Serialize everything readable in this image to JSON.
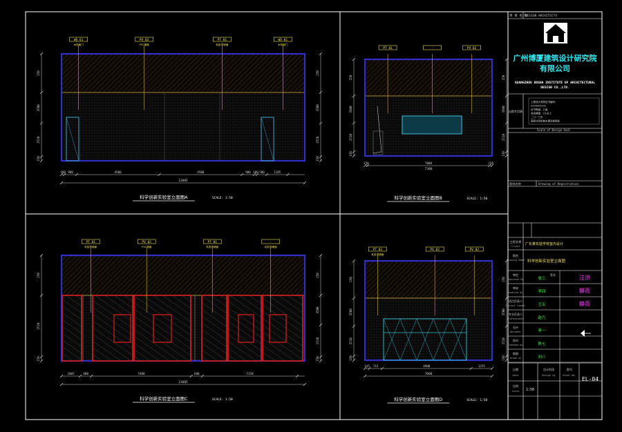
{
  "colors": {
    "background": "#000000",
    "frame": "#ffffff",
    "wall": "#3030c8",
    "hatch": "#7a5a28",
    "dim": "#d8d8d8",
    "leader": "#e0b040",
    "tag": "#f0e060",
    "panel_red": "#e02020",
    "cyan_title": "#30e8f0",
    "green_text": "#40ff40",
    "magenta_text": "#ff40ff"
  },
  "drawings": [
    {
      "id": "A",
      "title": "科学创新实验室立面图A",
      "scale": "SCALE: 1:50",
      "tags": [
        {
          "code": "WD 01",
          "note": "木饰面门"
        },
        {
          "code": "PV 02",
          "note": "PVC墙面"
        },
        {
          "code": "PT 01",
          "note": "乳胶漆墙面"
        },
        {
          "code": "WD 01",
          "note": "木饰面门"
        }
      ],
      "segment_dims": [
        "100",
        "900",
        "4500",
        "4500",
        "900",
        "100",
        "500",
        "1185"
      ],
      "overall_dim": "13085",
      "heights_left": [
        "250",
        "3500",
        "2510",
        "150"
      ],
      "heights_right": [
        "250",
        "3500",
        "2510",
        "150"
      ]
    },
    {
      "id": "B",
      "title": "科学创新实验室立面图B",
      "scale": "SCALE: 1:50",
      "tags": [
        {
          "code": "PT 01",
          "note": ""
        },
        {
          "code": "-",
          "note": ""
        },
        {
          "code": "PV 02",
          "note": ""
        }
      ],
      "segment_dims": [
        "150",
        "7000",
        "150"
      ],
      "overall_dim": "7300",
      "heights_left": [
        "250",
        "3500",
        "2510",
        "150"
      ],
      "heights_right": [
        "250",
        "3500",
        "2510",
        "150"
      ]
    },
    {
      "id": "C",
      "title": "科学创新实验室立面图C",
      "scale": "SCALE: 1:50",
      "tags": [
        {
          "code": "PT 01",
          "note": "乳胶漆墙面"
        },
        {
          "code": "PV 02",
          "note": "PVC墙面"
        },
        {
          "code": "PT 01",
          "note": "乳胶漆墙面"
        },
        {
          "code": "-",
          "note": "乳胶漆墙面"
        }
      ],
      "segment_dims": [
        "1005",
        "600",
        "5400",
        "600",
        "5150"
      ],
      "overall_dim": "13085",
      "heights_left": [
        "250",
        "2510",
        "150"
      ],
      "heights_right": [
        "250",
        "3500",
        "2510",
        "150"
      ]
    },
    {
      "id": "D",
      "title": "科学创新实验室立面图D",
      "scale": "SCALE: 1:50",
      "tags": [
        {
          "code": "PT 01",
          "note": "乳胶漆墙面"
        },
        {
          "code": "PV 02",
          "note": ""
        },
        {
          "code": "PV 02",
          "note": ""
        }
      ],
      "segment_dims": [
        "245",
        "715",
        "4900",
        "1255"
      ],
      "overall_dim": "7000",
      "heights_left": [
        "250",
        "3500",
        "2510",
        "150"
      ],
      "heights_right": [
        "250",
        "3500",
        "2510",
        "150"
      ]
    }
  ],
  "title_block": {
    "header_left": "项 目 名 称",
    "header_right": "DESIGN ARCHITECTS",
    "company_cn": "广州博厦建筑设计研究院有限公司",
    "company_cn_line1": "广州博厦建筑设计研究院",
    "company_cn_line2": "有限公司",
    "company_en_line1": "GUANGZHOU BOSHA INSTITUTE OF ARCHITECTURAL",
    "company_en_line2": "DESIGN CO.,LTD.",
    "seal_label": "出图专用章",
    "seal_lines": [
      "工程设计资质证书编号：",
      "A144005241",
      "证书等级：乙级",
      "有效期限：2018.5",
      "二〇一三年",
      "国家住房和城乡建设部颁发"
    ],
    "seal_note": "Scale of Design Seal",
    "drawing_of_label": "图纸名称",
    "drawing_of_en": "Drawing of Registration",
    "project_label": "工程名称",
    "project_en": "Client",
    "project_value": "广东某实验学校室内设计",
    "drawing_name_label": "图名",
    "drawing_name_en": "Drawing Name",
    "drawing_name_value": "科学创新实验室立面图",
    "rows": [
      {
        "label": "审定",
        "en": "Approved by",
        "role": "签名",
        "value": "张三",
        "signature": "汪洪"
      },
      {
        "label": "审核",
        "en": "Audited by",
        "role": "",
        "value": "李四",
        "signature": "静雨"
      },
      {
        "label": "项目负责人",
        "en": "Project leader",
        "role": "",
        "value": "王五",
        "signature": "静雨"
      },
      {
        "label": "专业负责人",
        "en": "Professional",
        "role": "",
        "value": "赵六",
        "signature": ""
      },
      {
        "label": "设计",
        "en": "Designer",
        "role": "",
        "value": "李一",
        "signature": ""
      },
      {
        "label": "校对",
        "en": "Checked by",
        "role": "",
        "value": "陈七",
        "signature": ""
      },
      {
        "label": "制图",
        "en": "Drawn by",
        "role": "",
        "value": "刘八",
        "signature": ""
      }
    ],
    "bottom": {
      "date_label": "日期",
      "date_en": "Date",
      "date_value": "",
      "scale_label": "比例",
      "scale_en": "Scale",
      "scale_value": "1:50",
      "stage_label": "设计阶段",
      "stage_en": "Design by",
      "sheet_label": "图号",
      "sheet_en": "Sheet No.",
      "sheet_value": "EL-04"
    }
  }
}
